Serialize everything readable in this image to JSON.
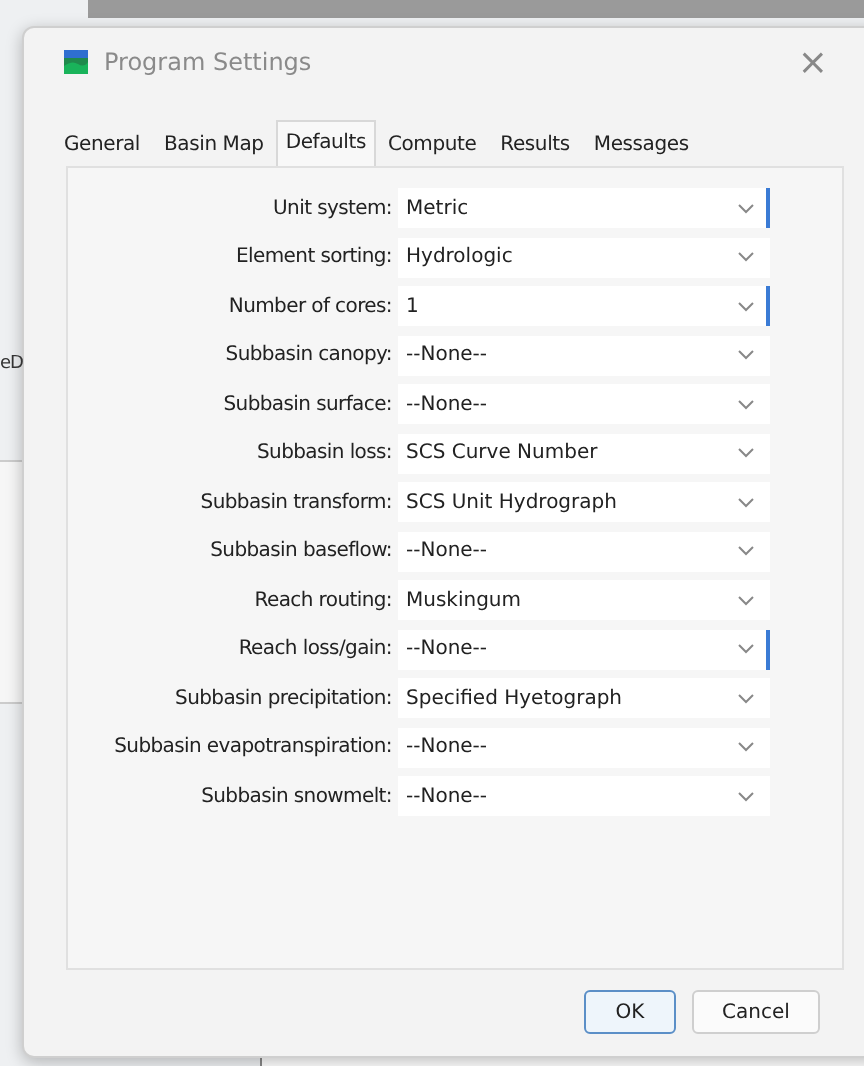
{
  "background": {
    "side_text": "eD"
  },
  "window": {
    "title": "Program Settings",
    "close": "×"
  },
  "tabs": [
    {
      "label": "General",
      "selected": false
    },
    {
      "label": "Basin Map",
      "selected": false
    },
    {
      "label": "Defaults",
      "selected": true
    },
    {
      "label": "Compute",
      "selected": false
    },
    {
      "label": "Results",
      "selected": false
    },
    {
      "label": "Messages",
      "selected": false
    }
  ],
  "fields": [
    {
      "label": "Unit system:",
      "value": "Metric",
      "focused": true
    },
    {
      "label": "Element sorting:",
      "value": "Hydrologic",
      "focused": false
    },
    {
      "label": "Number of cores:",
      "value": "1",
      "focused": true
    },
    {
      "label": "Subbasin canopy:",
      "value": "--None--",
      "focused": false
    },
    {
      "label": "Subbasin surface:",
      "value": "--None--",
      "focused": false
    },
    {
      "label": "Subbasin loss:",
      "value": "SCS Curve Number",
      "focused": false
    },
    {
      "label": "Subbasin transform:",
      "value": "SCS Unit Hydrograph",
      "focused": false
    },
    {
      "label": "Subbasin baseflow:",
      "value": "--None--",
      "focused": false
    },
    {
      "label": "Reach routing:",
      "value": "Muskingum",
      "focused": false
    },
    {
      "label": "Reach loss/gain:",
      "value": "--None--",
      "focused": true
    },
    {
      "label": "Subbasin precipitation:",
      "value": "Specified Hyetograph",
      "focused": false
    },
    {
      "label": "Subbasin evapotranspiration:",
      "value": "--None--",
      "focused": false
    },
    {
      "label": "Subbasin snowmelt:",
      "value": "--None--",
      "focused": false
    }
  ],
  "buttons": [
    {
      "label": "OK",
      "default": true
    },
    {
      "label": "Cancel",
      "default": false
    }
  ]
}
